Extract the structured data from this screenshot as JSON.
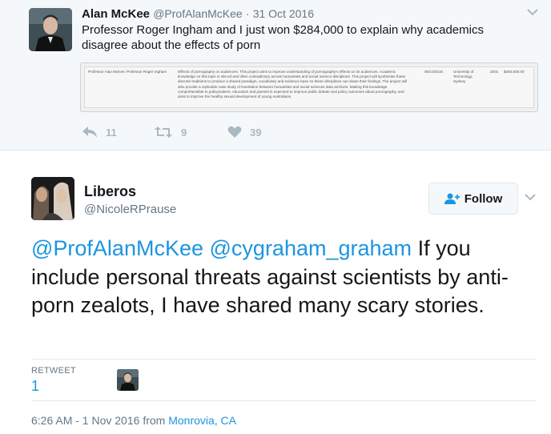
{
  "parent_tweet": {
    "name": "Alan McKee",
    "handle": "@ProfAlanMcKee",
    "separator": "·",
    "date": "31 Oct 2016",
    "text": "Professor Roger Ingham and I just won $284,000 to explain why academics disagree about the effects of porn",
    "document": {
      "investigators": "Professor Alan McKee; Professor Roger Ingham",
      "summary": "Effects of pornography on audiences. This project aims to improve understanding of pornography's effects on its audiences. Academic knowledge on this topic is silo-ed and often contradictory across humanities and social science disciplines. This project will synthesise these discrete traditions to produce a shared paradigm, vocabulary and evidence base so these disciplines can share their findings. The project will also provide a replicable case study of translation between humanities and social sciences data archives. Making this knowledge comprehensible to policymakers, educators and parents is expected to improve public debate and policy outcomes about pornography, and aims to improve the healthy sexual development of young Australians.",
      "date": "05/10/2016",
      "organisation": "University of Technology, Sydney",
      "year": "2001",
      "amount": "$284,500.00"
    },
    "actions": {
      "reply_count": "11",
      "retweet_count": "9",
      "like_count": "39"
    },
    "icons": {
      "reply": "reply-icon",
      "retweet": "retweet-icon",
      "like": "heart-icon",
      "menu": "chevron-down-icon"
    }
  },
  "main_tweet": {
    "name": "Liberos",
    "handle": "@NicoleRPrause",
    "follow_label": "Follow",
    "mention_1": "@ProfAlanMcKee",
    "mention_2": "@cygraham_graham",
    "body": "If you include personal threats against scientists by anti-porn zealots, I have shared many scary stories.",
    "retweet_label": "RETWEET",
    "retweet_count": "1",
    "timestamp": "6:26 AM - 1 Nov 2016",
    "from_label": "from",
    "location": "Monrovia, CA",
    "icons": {
      "follow": "add-user-icon",
      "menu": "chevron-down-icon"
    }
  },
  "colors": {
    "link": "#1b95e0",
    "secondary_text": "#657786",
    "action_icons": "#aab8c2",
    "parent_background": "#f5f8fa"
  }
}
